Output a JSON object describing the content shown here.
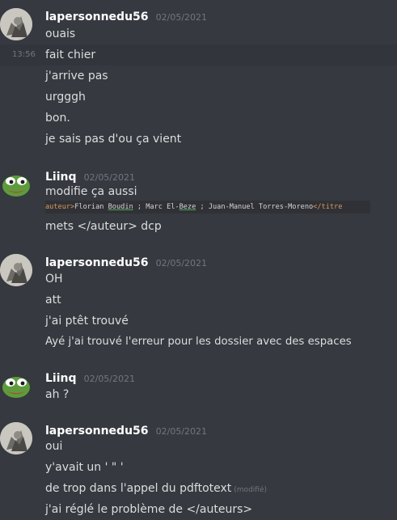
{
  "users": {
    "lapersonne": "lapersonnedu56",
    "liinq": "Liinq"
  },
  "groups": [
    {
      "timestamp": "02/05/2021",
      "lines": [
        "ouais",
        "fait chier",
        "j'arrive pas",
        "urgggh",
        "bon.",
        "je sais pas d'ou ça vient"
      ],
      "hover_time": "13:56"
    },
    {
      "timestamp": "02/05/2021",
      "lines": [
        "modifie ça aussi",
        "mets </auteur> dcp"
      ],
      "code": {
        "tag_open": "auteur>",
        "name1": "Florian ",
        "name1b": "Boudin",
        "sep1": " ; Marc El-",
        "name2b": "Beze",
        "sep2": " ; Juan-Manuel Torres-Moreno",
        "tag_close": "</titre"
      }
    },
    {
      "timestamp": "02/05/2021",
      "lines": [
        "OH",
        "att",
        "j'ai ptêt trouvé",
        "Ayé j'ai trouvé l'erreur pour les dossier avec des espaces"
      ]
    },
    {
      "timestamp": "02/05/2021",
      "lines": [
        "ah ?"
      ]
    },
    {
      "timestamp": "02/05/2021",
      "lines": [
        "oui",
        "y'avait un ' \" '",
        "de trop dans l'appel du pdftotext",
        "j'ai réglé le problème de </auteurs>"
      ],
      "edited_label": "(modifié)"
    }
  ],
  "colors": {
    "background": "#36393f",
    "username": "#ffffff",
    "text": "#dcddde",
    "muted": "#72767d"
  }
}
